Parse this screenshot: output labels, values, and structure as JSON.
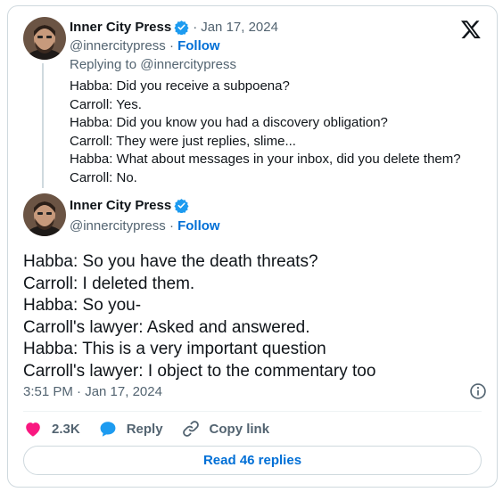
{
  "quoted_tweet": {
    "author_name": "Inner City Press",
    "date": "Jan 17, 2024",
    "handle": "@innercitypress",
    "follow_label": "Follow",
    "replying_to": "Replying to @innercitypress",
    "lines": [
      "Habba: Did you receive a subpoena?",
      "Carroll: Yes.",
      "Habba: Did you know you had a discovery obligation?",
      "Carroll: They were just replies, slime...",
      "Habba: What about messages in your inbox, did you delete them?",
      "Carroll: No."
    ]
  },
  "main_tweet": {
    "author_name": "Inner City Press",
    "handle": "@innercitypress",
    "follow_label": "Follow",
    "lines": [
      "Habba: So you have the death threats?",
      "Carroll: I deleted them.",
      "Habba: So you-",
      "Carroll's lawyer: Asked and answered.",
      "Habba: This is a very important question",
      "Carroll's lawyer: I object to the commentary too"
    ],
    "timestamp": "3:51 PM · Jan 17, 2024",
    "likes": "2.3K",
    "reply_label": "Reply",
    "copy_link_label": "Copy link",
    "read_replies_label": "Read 46 replies"
  },
  "icons": {
    "brand": "x-logo-icon",
    "verified": "verified-badge-icon",
    "info": "info-icon",
    "like": "heart-icon",
    "reply": "reply-bubble-icon",
    "copy": "link-icon"
  },
  "colors": {
    "accent": "#006fd6",
    "verified": "#1d9bf0",
    "heart": "#f91880",
    "text": "#0f1419",
    "muted": "#536471",
    "border": "#cfd9de"
  }
}
